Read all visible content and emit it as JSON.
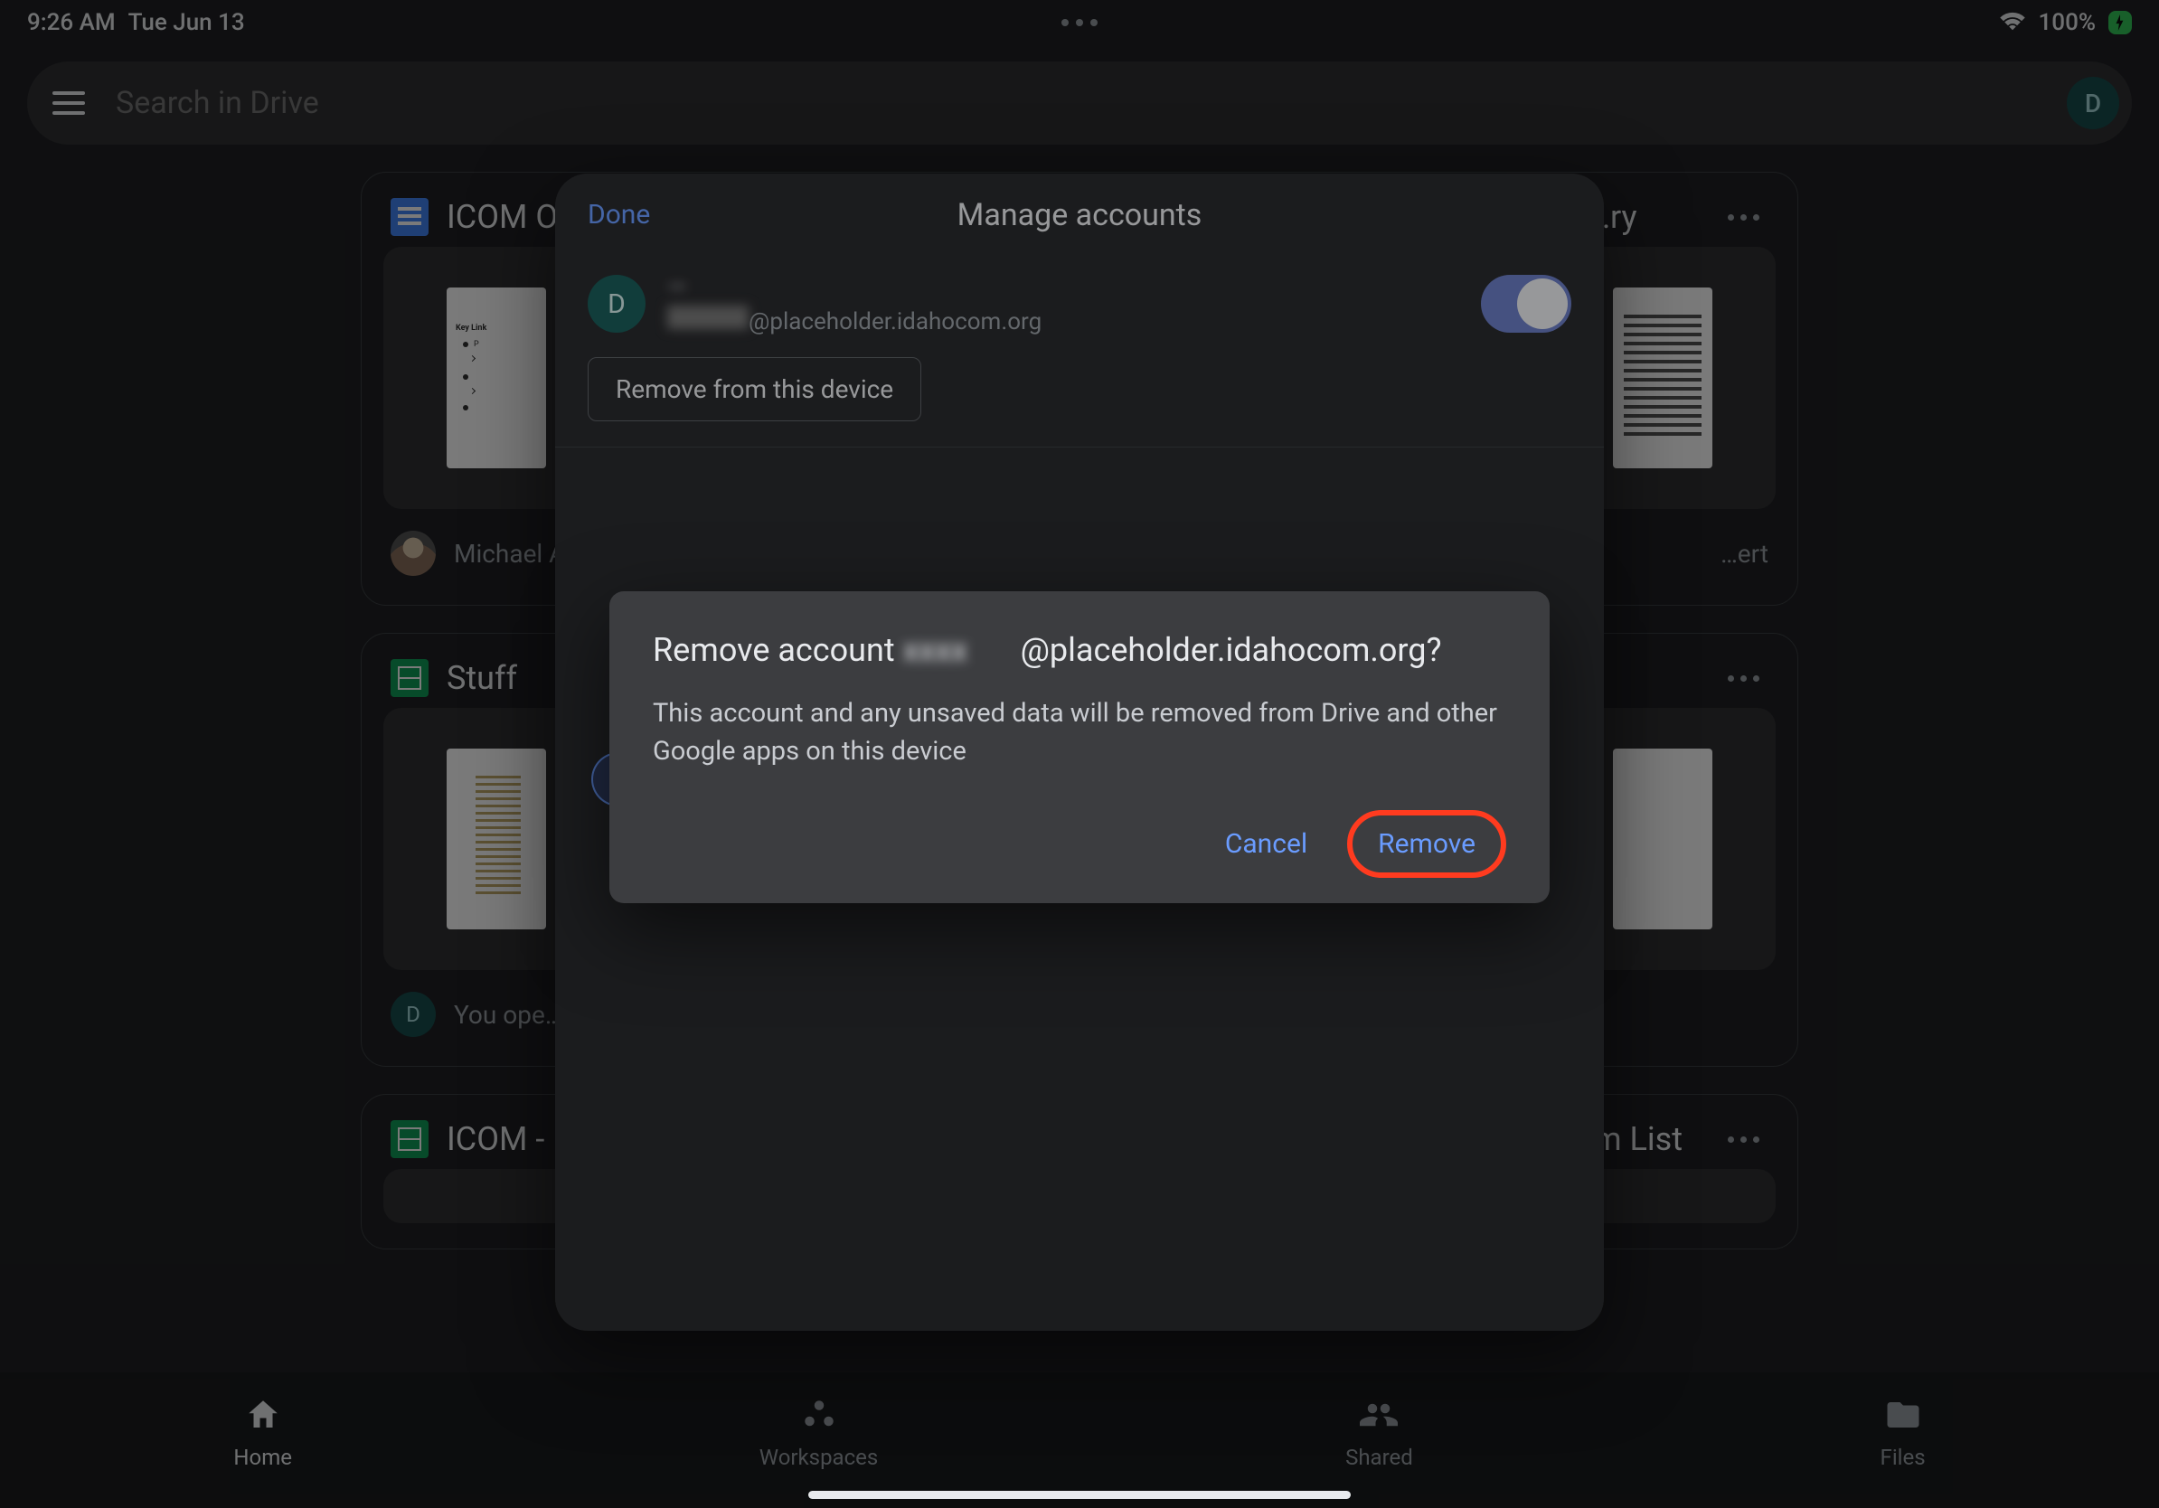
{
  "status": {
    "time": "9:26 AM",
    "date": "Tue Jun 13",
    "battery": "100%"
  },
  "header": {
    "search_placeholder": "Search in Drive",
    "avatar_initial": "D"
  },
  "cards": {
    "c0": {
      "title": "ICOM O…",
      "footer_text": "Michael A…",
      "footer_right": "…ert"
    },
    "c1": {
      "title": "Stuff",
      "footer_initial": "D",
      "footer_text": "You ope…"
    },
    "c2": {
      "title": "ICOM -",
      "right_label": "…em List"
    }
  },
  "sheet": {
    "done": "Done",
    "title": "Manage accounts",
    "account": {
      "avatar_initial": "D",
      "name": "—",
      "email_suffix": "@placeholder.idahocom.org"
    },
    "remove_device_label": "Remove from this device"
  },
  "dialog": {
    "title_prefix": "Remove account",
    "title_email": "@placeholder.idahocom.org",
    "title_suffix": "?",
    "body": "This account and any unsaved data will be removed from Drive and other Google apps on this device",
    "cancel_label": "Cancel",
    "remove_label": "Remove"
  },
  "nav": {
    "home": "Home",
    "workspaces": "Workspaces",
    "shared": "Shared",
    "files": "Files"
  }
}
